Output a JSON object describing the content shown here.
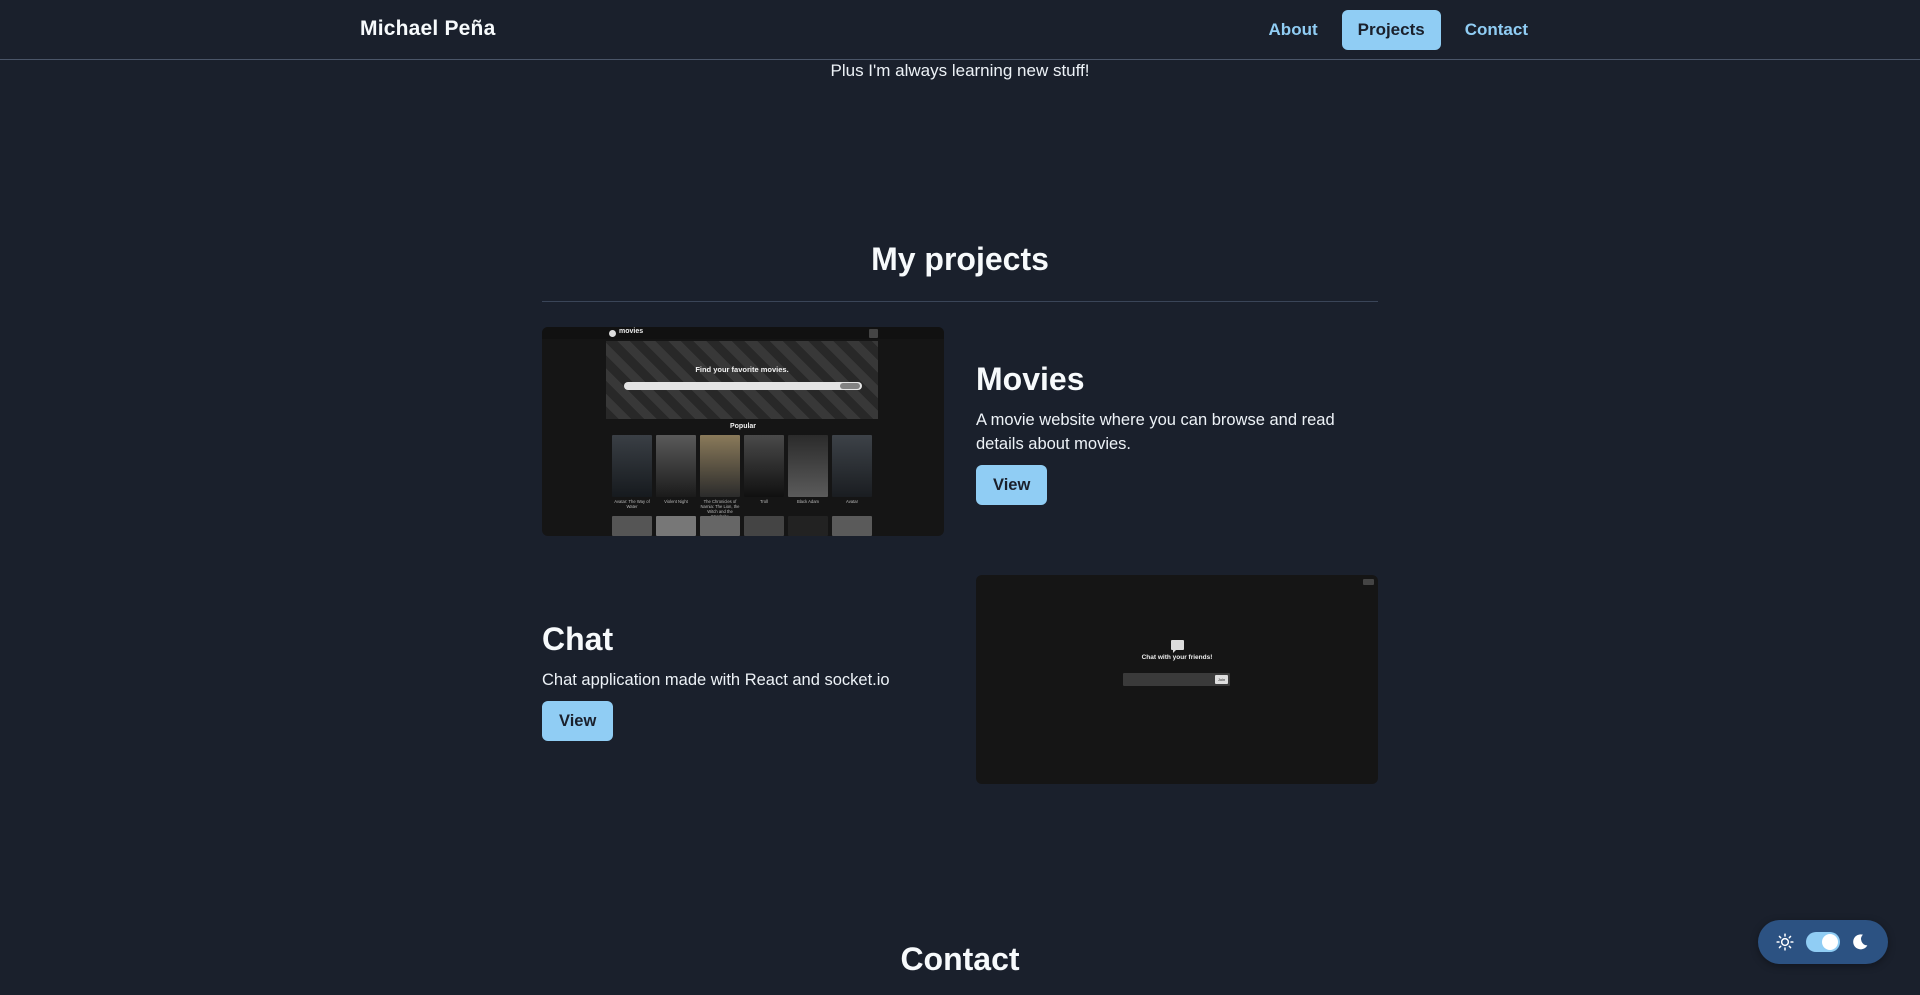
{
  "header": {
    "brand": "Michael Peña",
    "nav": [
      {
        "label": "About",
        "active": false
      },
      {
        "label": "Projects",
        "active": true
      },
      {
        "label": "Contact",
        "active": false
      }
    ]
  },
  "intro": {
    "learning_text": "Plus I'm always learning new stuff!"
  },
  "projects": {
    "title": "My projects",
    "items": [
      {
        "title": "Movies",
        "description": "A movie website where you can browse and read details about movies.",
        "button_label": "View",
        "screenshot": {
          "logo_text": "movies",
          "hero_title": "Find your favorite movies.",
          "section_label": "Popular",
          "captions": [
            "Avatar: The Way of Water",
            "Violent Night",
            "The Chronicles of Narnia: The Lion, the Witch and the Wardrobe",
            "Troll",
            "Black Adam",
            "Avatar"
          ]
        }
      },
      {
        "title": "Chat",
        "description": "Chat application made with React and socket.io",
        "button_label": "View",
        "screenshot": {
          "hero_title": "Chat with your friends!",
          "button_text": "Join"
        }
      }
    ]
  },
  "contact": {
    "title": "Contact"
  },
  "theme_toggle": {
    "sun_icon": "sun-icon",
    "moon_icon": "moon-icon",
    "mode": "dark"
  },
  "colors": {
    "background": "#1a202c",
    "accent": "#90cdf4",
    "toggle_bg": "#2c5282"
  }
}
